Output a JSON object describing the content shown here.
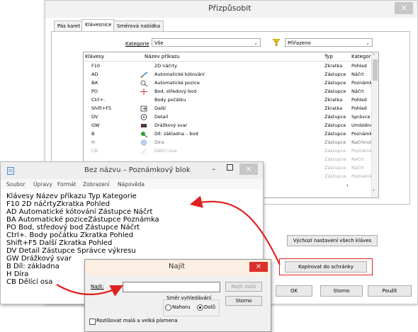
{
  "dialog": {
    "title": "Přizpůsobit",
    "close": "×",
    "tabs": [
      "Pás karet",
      "Klávesnice",
      "Směrová nabídka"
    ],
    "category_label": "Kategorie",
    "category_value": "Vše",
    "filter_value": "Přiřazeno",
    "columns": [
      "Klávesy",
      "Název příkazu",
      "Typ",
      "Kategorie"
    ],
    "rows": [
      {
        "key": "F10",
        "name": "2D náčrty",
        "type": "Zkratka",
        "cat": "Pohled",
        "icon": "none-icon"
      },
      {
        "key": "AD",
        "name": "Automatické kótování",
        "type": "Zástupce",
        "cat": "Náčrt",
        "icon": "auto-dimension-icon"
      },
      {
        "key": "BA",
        "name": "Automatické pozice",
        "type": "Zástupce",
        "cat": "Poznámka",
        "icon": "auto-balloon-icon"
      },
      {
        "key": "PO",
        "name": "Bod, středový bod",
        "type": "Zástupce",
        "cat": "Náčrt",
        "icon": "center-point-icon"
      },
      {
        "key": "Ctrl+.",
        "name": "Body počátku",
        "type": "Zkratka",
        "cat": "Pohled",
        "icon": "none-icon"
      },
      {
        "key": "Shift+F5",
        "name": "Další",
        "type": "Zkratka",
        "cat": "Pohled",
        "icon": "next-view-icon"
      },
      {
        "key": "DV",
        "name": "Detail",
        "type": "Zástupce",
        "cat": "Správce",
        "icon": "detail-view-icon"
      },
      {
        "key": "GW",
        "name": "Drážkový svar",
        "type": "Zástupce",
        "cat": "Umístěné",
        "icon": "groove-weld-icon"
      },
      {
        "key": "B",
        "name": "Díl: základna – bod",
        "type": "Zástupce",
        "cat": "Poznámka",
        "icon": "datum-point-icon"
      },
      {
        "key": "H",
        "name": "Díra",
        "type": "Zástupce",
        "cat": "Načrtnut",
        "icon": "hole-icon"
      },
      {
        "key": "CB",
        "name": "Dělící osa",
        "type": "Zástupce",
        "cat": "Poznámka",
        "icon": "bisector-icon"
      },
      {
        "key": "",
        "name": "",
        "type": "Zástupce",
        "cat": "Náčrt",
        "icon": "none-icon"
      },
      {
        "key": "",
        "name": "",
        "type": "Zástupce",
        "cat": "Náčrt",
        "icon": "none-icon"
      },
      {
        "key": "",
        "name": "",
        "type": "Zástupce",
        "cat": "Poznámka",
        "icon": "none-icon"
      }
    ],
    "reset_btn": "Výchozí nastavení všech kláves",
    "copy_btn": "Kopírovat do schránky",
    "ok_btn": "OK",
    "cancel_btn": "Storno",
    "apply_btn": "Použít"
  },
  "notepad": {
    "title": "Bez názvu – Poznámkový blok",
    "menu": [
      "Soubor",
      "Úpravy",
      "Formát",
      "Zobrazení",
      "Nápověda"
    ],
    "lines": [
      "Klávesy  Název příkazu     Typ       Kategorie",
      "F10      2D náčrtyZkratka  Pohled",
      "AD       Automatické kótování       Zástupce Náčrt",
      "BA       Automatické poziceZástupce Poznámka",
      "PO       Bod, středový bod  Zástupce Náčrt",
      "Ctrl+.   Body počátku      Zkratka  Pohled",
      "Shift+F5 Další    Zkratka  Pohled",
      "DV       Detail   Zástupce Správce výkresu",
      "GW       Drážkový svar",
      "B        Díl: základna",
      "H        Díra",
      "CB       Dělící osa"
    ]
  },
  "find": {
    "title": "Najít",
    "close": "×",
    "find_label": "Najít:",
    "find_value": "",
    "find_next_btn": "Najít další",
    "cancel_btn": "Storno",
    "direction_label": "Směr vyhledávání",
    "up": "Nahoru",
    "down": "Dolů",
    "match_case": "Rozlišovat malá a velká písmena"
  },
  "colors": {
    "highlight": "#e02020",
    "filter_icon": "#f2c200"
  }
}
